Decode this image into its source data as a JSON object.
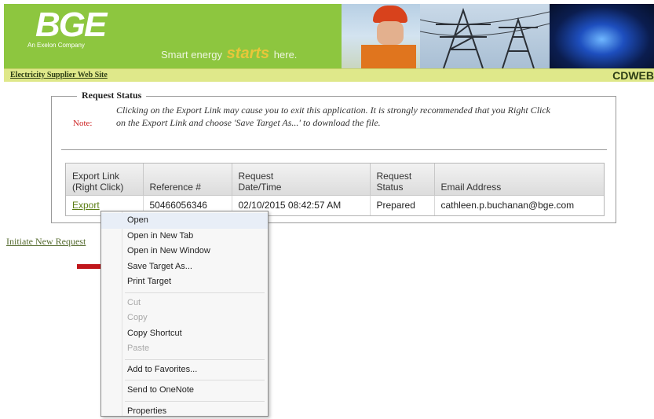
{
  "header": {
    "logo": "BGE",
    "logo_sub": "An Exelon Company",
    "tagline_pre": "Smart energy",
    "tagline_mid": "starts",
    "tagline_post": "here."
  },
  "subbar": {
    "site_link": "Electricity Supplier Web Site",
    "code": "CDWEB"
  },
  "request_status": {
    "legend": "Request Status",
    "note_label": "Note:",
    "note_text": "Clicking on the Export Link may cause you to exit this application. It is strongly recommended that you Right Click on the Export Link and choose 'Save Target As...' to download the file."
  },
  "table": {
    "headers": [
      {
        "line1": "Export Link",
        "line2": "(Right Click)"
      },
      {
        "line1": "",
        "line2": "Reference #"
      },
      {
        "line1": "Request",
        "line2": "Date/Time"
      },
      {
        "line1": "Request",
        "line2": "Status"
      },
      {
        "line1": "",
        "line2": "Email Address"
      }
    ],
    "rows": [
      {
        "export": "Export",
        "reference": "50466056346",
        "datetime": "02/10/2015 08:42:57 AM",
        "status": "Prepared",
        "email": "cathleen.p.buchanan@bge.com"
      }
    ]
  },
  "initiate_link": "Initiate New Request",
  "context_menu": {
    "items": [
      {
        "label": "Open"
      },
      {
        "label": "Open in New Tab"
      },
      {
        "label": "Open in New Window"
      },
      {
        "label": "Save Target As..."
      },
      {
        "label": "Print Target"
      },
      {
        "label": "Cut"
      },
      {
        "label": "Copy"
      },
      {
        "label": "Copy Shortcut"
      },
      {
        "label": "Paste"
      },
      {
        "label": "Add to Favorites..."
      },
      {
        "label": "Send to OneNote"
      },
      {
        "label": "Properties"
      }
    ]
  },
  "colors": {
    "banner_green": "#8dc63f",
    "subbar": "#dfe88a",
    "arrow_red": "#c0161b",
    "note_red": "#cc2020"
  }
}
